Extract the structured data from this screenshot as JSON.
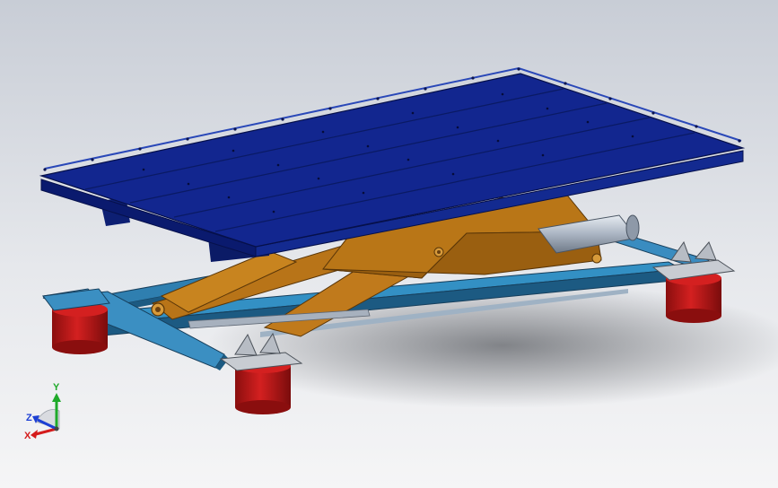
{
  "colors": {
    "background_top": "#c9ced6",
    "background_bottom": "#f3f4f6",
    "platform_top": "#10248f",
    "platform_edge": "#0a1a6e",
    "rail": "#1b3fa8",
    "scissor_arm": "#b87418",
    "scissor_arm_dark": "#8a5510",
    "base_frame": "#2f7fb0",
    "base_frame_dark": "#1c5a82",
    "foot": "#c01818",
    "foot_dark": "#8a0e0e",
    "mount_plate": "#c8ccd2",
    "cylinder": "#b9c2cf",
    "axis_x": "#d41c1c",
    "axis_y": "#1faa2a",
    "axis_z": "#1c3fd4"
  },
  "triad": {
    "x_label": "X",
    "y_label": "Y",
    "z_label": "Z"
  }
}
